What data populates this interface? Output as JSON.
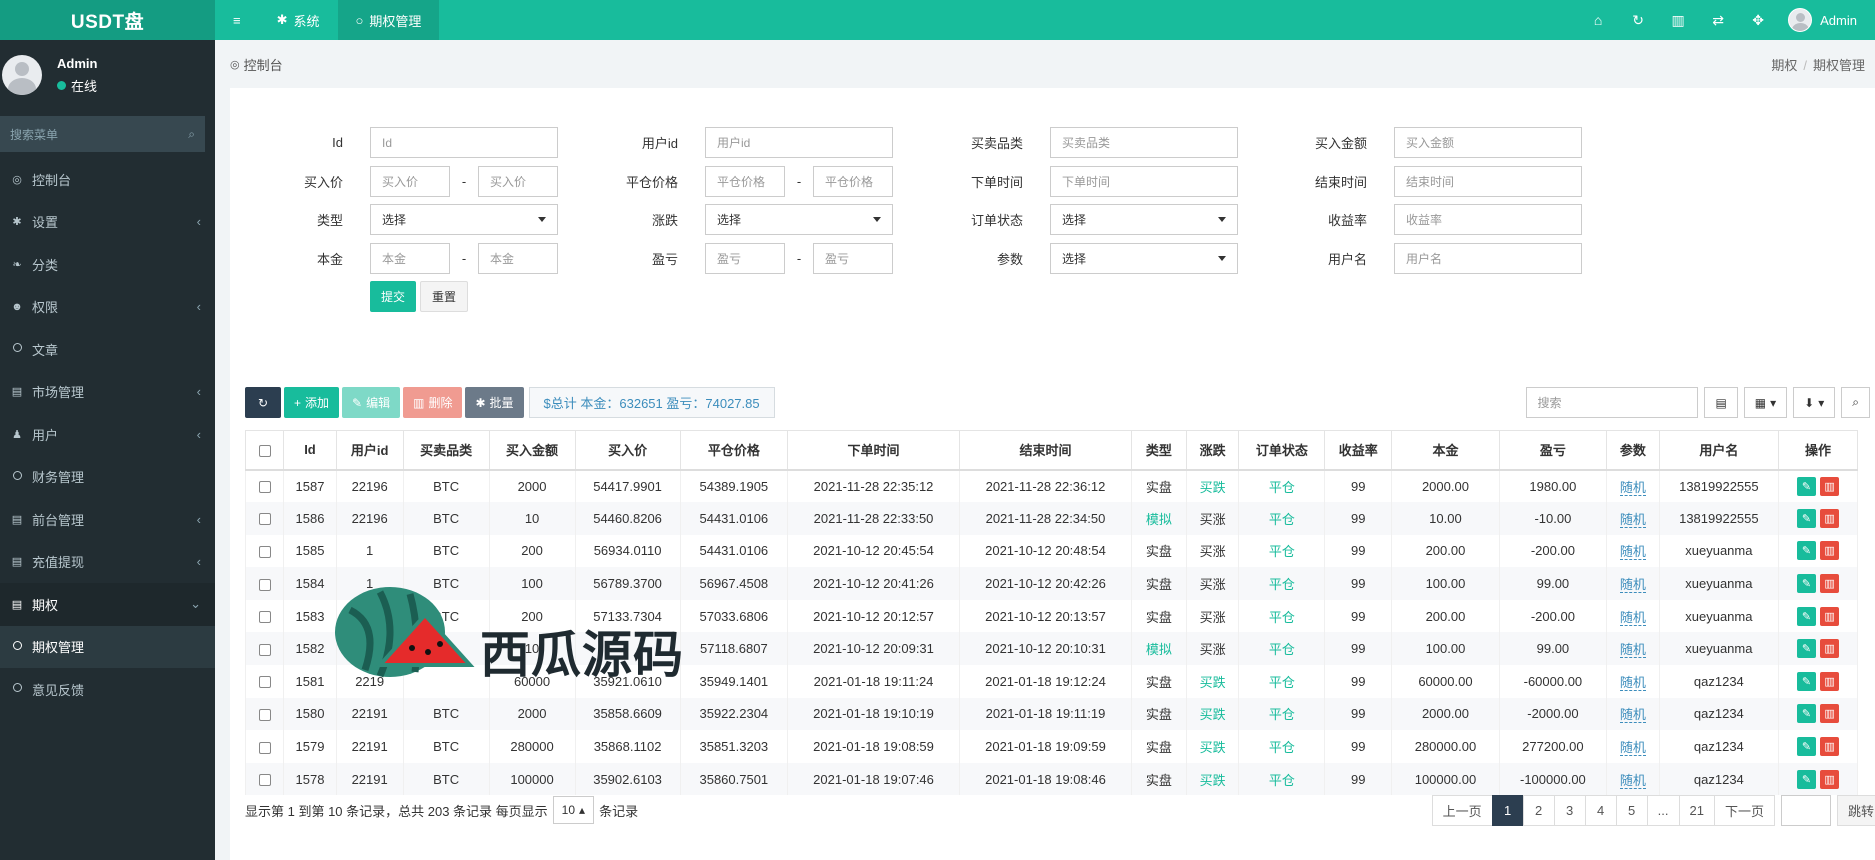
{
  "brand": "USDT盘",
  "topnav": [
    {
      "icon": "menu-icon",
      "glyph": "≡",
      "label": ""
    },
    {
      "icon": "gear-icon",
      "glyph": "✱",
      "label": "系统"
    },
    {
      "icon": "circle-icon",
      "glyph": "○",
      "label": "期权管理"
    }
  ],
  "topright_icons": [
    {
      "name": "home-icon",
      "glyph": "⌂"
    },
    {
      "name": "refresh-icon",
      "glyph": "↻"
    },
    {
      "name": "trash-icon",
      "glyph": "▥"
    },
    {
      "name": "language-icon",
      "glyph": "⇄"
    },
    {
      "name": "fullscreen-icon",
      "glyph": "✥"
    }
  ],
  "top_user": "Admin",
  "sidebar": {
    "user_name": "Admin",
    "status": "在线",
    "search_placeholder": "搜索菜单",
    "items": [
      {
        "icon": "dashboard-icon",
        "glyph": "◎",
        "label": "控制台",
        "chev": ""
      },
      {
        "icon": "cogs-icon",
        "glyph": "✱",
        "label": "设置",
        "chev": "‹"
      },
      {
        "icon": "leaf-icon",
        "glyph": "❧",
        "label": "分类",
        "chev": ""
      },
      {
        "icon": "group-icon",
        "glyph": "☻",
        "label": "权限",
        "chev": "‹"
      },
      {
        "icon": "circle-icon",
        "glyph": "",
        "label": "文章",
        "chev": ""
      },
      {
        "icon": "list-icon",
        "glyph": "▤",
        "label": "市场管理",
        "chev": "‹"
      },
      {
        "icon": "user-icon",
        "glyph": "♟",
        "label": "用户",
        "chev": "‹"
      },
      {
        "icon": "circle-icon",
        "glyph": "",
        "label": "财务管理",
        "chev": ""
      },
      {
        "icon": "list-icon",
        "glyph": "▤",
        "label": "前台管理",
        "chev": "‹"
      },
      {
        "icon": "list-icon",
        "glyph": "▤",
        "label": "充值提现",
        "chev": "‹"
      },
      {
        "icon": "list-icon",
        "glyph": "▤",
        "label": "期权",
        "chev": "⌄"
      },
      {
        "icon": "circle-icon",
        "glyph": "",
        "label": "期权管理",
        "chev": ""
      },
      {
        "icon": "circle-icon",
        "glyph": "",
        "label": "意见反馈",
        "chev": ""
      }
    ]
  },
  "breadcrumb": {
    "current": "控制台",
    "path1": "期权",
    "path2": "期权管理"
  },
  "filters": {
    "id": {
      "label": "Id",
      "ph": "Id"
    },
    "uid": {
      "label": "用户id",
      "ph": "用户id"
    },
    "cat": {
      "label": "买卖品类",
      "ph": "买卖品类"
    },
    "amount": {
      "label": "买入金额",
      "ph": "买入金额"
    },
    "buy": {
      "label": "买入价",
      "ph": "买入价"
    },
    "close": {
      "label": "平仓价格",
      "ph": "平仓价格"
    },
    "otime": {
      "label": "下单时间",
      "ph": "下单时间"
    },
    "etime": {
      "label": "结束时间",
      "ph": "结束时间"
    },
    "type": {
      "label": "类型",
      "val": "选择"
    },
    "updown": {
      "label": "涨跌",
      "val": "选择"
    },
    "status": {
      "label": "订单状态",
      "val": "选择"
    },
    "rate": {
      "label": "收益率",
      "ph": "收益率"
    },
    "principal": {
      "label": "本金",
      "ph": "本金"
    },
    "pnl": {
      "label": "盈亏",
      "ph": "盈亏"
    },
    "param": {
      "label": "参数",
      "val": "选择"
    },
    "uname": {
      "label": "用户名",
      "ph": "用户名"
    },
    "dash": "-",
    "submit": "提交",
    "reset": "重置"
  },
  "toolbar": {
    "add": "添加",
    "edit": "编辑",
    "del": "删除",
    "batch": "批量",
    "total": "$总计 本金：632651 盈亏：74027.85",
    "search_ph": "搜索"
  },
  "table": {
    "headers": [
      "Id",
      "用户id",
      "买卖品类",
      "买入金额",
      "买入价",
      "平仓价格",
      "下单时间",
      "结束时间",
      "类型",
      "涨跌",
      "订单状态",
      "收益率",
      "本金",
      "盈亏",
      "参数",
      "用户名",
      "操作"
    ],
    "rows": [
      [
        "1587",
        "22196",
        "BTC",
        "2000",
        "54417.9901",
        "54389.1905",
        "2021-11-28 22:35:12",
        "2021-11-28 22:36:12",
        "实盘",
        "买跌",
        "平仓",
        "99",
        "2000.00",
        "1980.00",
        "随机",
        "13819922555"
      ],
      [
        "1586",
        "22196",
        "BTC",
        "10",
        "54460.8206",
        "54431.0106",
        "2021-11-28 22:33:50",
        "2021-11-28 22:34:50",
        "模拟",
        "买涨",
        "平仓",
        "99",
        "10.00",
        "-10.00",
        "随机",
        "13819922555"
      ],
      [
        "1585",
        "1",
        "BTC",
        "200",
        "56934.0110",
        "54431.0106",
        "2021-10-12 20:45:54",
        "2021-10-12 20:48:54",
        "实盘",
        "买涨",
        "平仓",
        "99",
        "200.00",
        "-200.00",
        "随机",
        "xueyuanma"
      ],
      [
        "1584",
        "1",
        "BTC",
        "100",
        "56789.3700",
        "56967.4508",
        "2021-10-12 20:41:26",
        "2021-10-12 20:42:26",
        "实盘",
        "买涨",
        "平仓",
        "99",
        "100.00",
        "99.00",
        "随机",
        "xueyuanma"
      ],
      [
        "1583",
        "",
        "BTC",
        "200",
        "57133.7304",
        "57033.6806",
        "2021-10-12 20:12:57",
        "2021-10-12 20:13:57",
        "实盘",
        "买涨",
        "平仓",
        "99",
        "200.00",
        "-200.00",
        "随机",
        "xueyuanma"
      ],
      [
        "1582",
        "",
        "",
        "10",
        "",
        "57118.6807",
        "2021-10-12 20:09:31",
        "2021-10-12 20:10:31",
        "模拟",
        "买涨",
        "平仓",
        "99",
        "100.00",
        "99.00",
        "随机",
        "xueyuanma"
      ],
      [
        "1581",
        "2219",
        "",
        "60000",
        "35921.0610",
        "35949.1401",
        "2021-01-18 19:11:24",
        "2021-01-18 19:12:24",
        "实盘",
        "买跌",
        "平仓",
        "99",
        "60000.00",
        "-60000.00",
        "随机",
        "qaz1234"
      ],
      [
        "1580",
        "22191",
        "BTC",
        "2000",
        "35858.6609",
        "35922.2304",
        "2021-01-18 19:10:19",
        "2021-01-18 19:11:19",
        "实盘",
        "买跌",
        "平仓",
        "99",
        "2000.00",
        "-2000.00",
        "随机",
        "qaz1234"
      ],
      [
        "1579",
        "22191",
        "BTC",
        "280000",
        "35868.1102",
        "35851.3203",
        "2021-01-18 19:08:59",
        "2021-01-18 19:09:59",
        "实盘",
        "买跌",
        "平仓",
        "99",
        "280000.00",
        "277200.00",
        "随机",
        "qaz1234"
      ],
      [
        "1578",
        "22191",
        "BTC",
        "100000",
        "35902.6103",
        "35860.7501",
        "2021-01-18 19:07:46",
        "2021-01-18 19:08:46",
        "实盘",
        "买跌",
        "平仓",
        "99",
        "100000.00",
        "-100000.00",
        "随机",
        "qaz1234"
      ]
    ]
  },
  "footer": {
    "info": "显示第 1 到第 10 条记录，总共 203 条记录 每页显示",
    "per_page": "10",
    "suffix": "条记录",
    "prev": "上一页",
    "pages": [
      "1",
      "2",
      "3",
      "4",
      "5",
      "...",
      "21"
    ],
    "next": "下一页",
    "go": "跳转"
  },
  "watermark": "西瓜源码",
  "colors": {
    "accent": "#18bc9c",
    "sidebar": "#222d32",
    "danger": "#e74c3c",
    "link": "#3c8dbc"
  }
}
